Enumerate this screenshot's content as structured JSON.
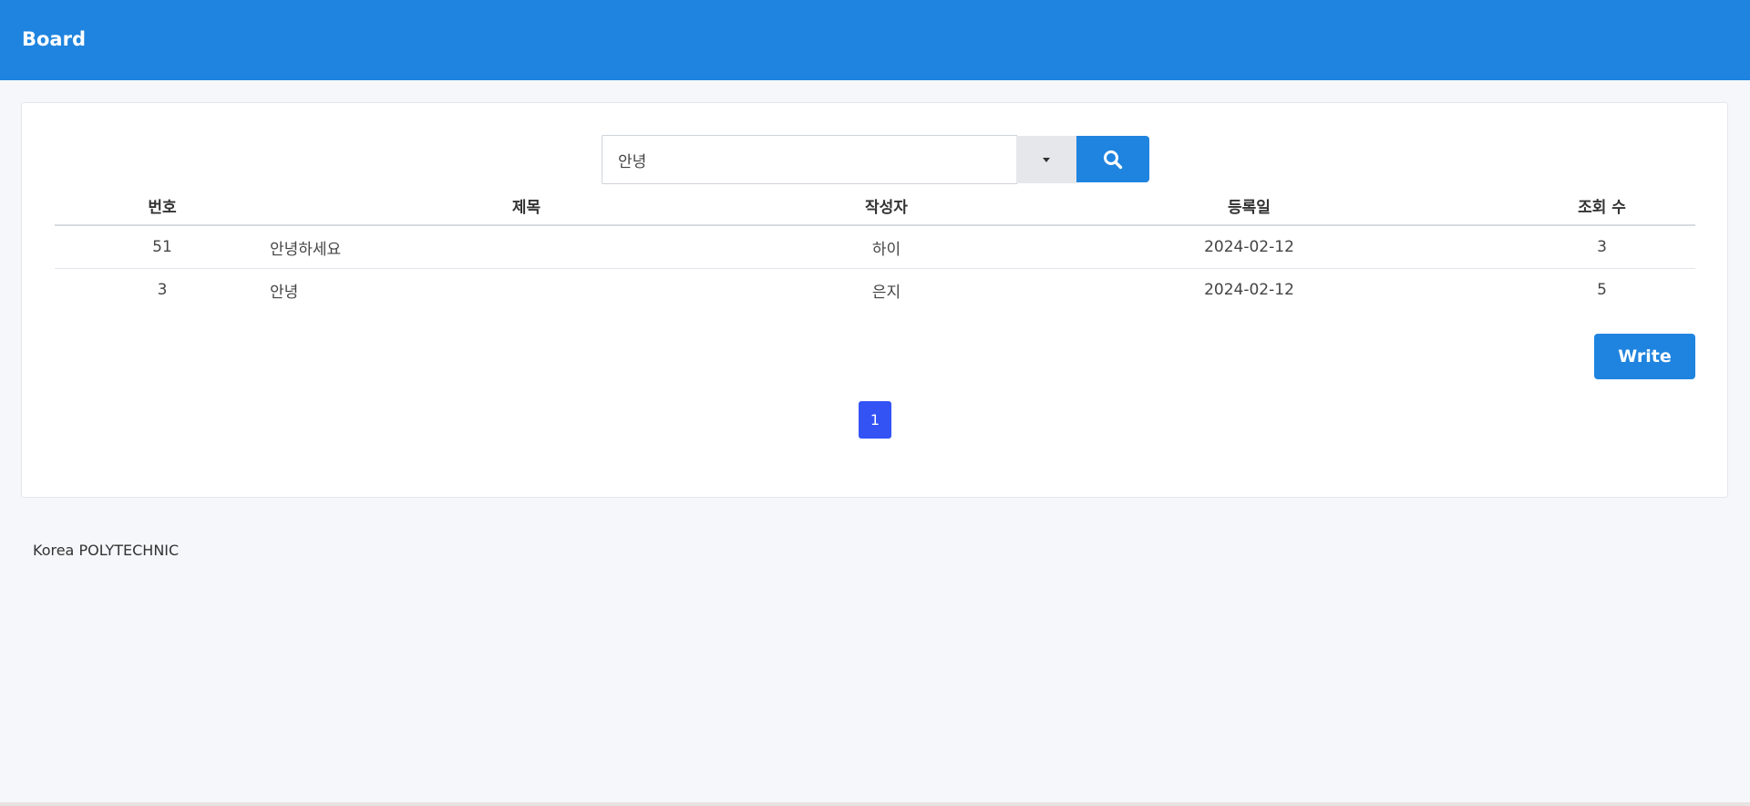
{
  "header": {
    "title": "Board"
  },
  "search": {
    "value": "안녕",
    "placeholder": ""
  },
  "table": {
    "columns": [
      "번호",
      "제목",
      "작성자",
      "등록일",
      "조회 수"
    ],
    "rows": [
      {
        "no": "51",
        "title": "안녕하세요",
        "author": "하이",
        "date": "2024-02-12",
        "views": "3"
      },
      {
        "no": "3",
        "title": "안녕",
        "author": "은지",
        "date": "2024-02-12",
        "views": "5"
      }
    ]
  },
  "actions": {
    "write_label": "Write"
  },
  "pagination": {
    "current_page": "1"
  },
  "footer": {
    "text": "Korea POLYTECHNIC"
  },
  "colors": {
    "header_bg": "#1f84df",
    "primary": "#1f84df",
    "page_active": "#3353f5",
    "background": "#f5f7fa"
  },
  "icons": {
    "search": "search-icon",
    "dropdown": "caret-down-icon"
  }
}
